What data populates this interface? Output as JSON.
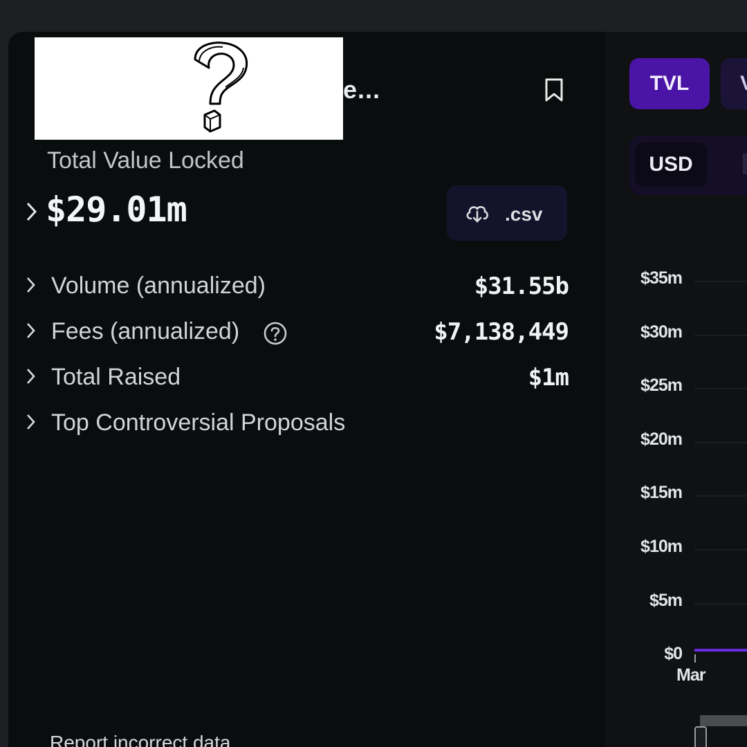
{
  "header": {
    "title_suffix": "e...",
    "bookmark_icon": "bookmark-icon"
  },
  "summary": {
    "tvl_label": "Total Value Locked",
    "tvl_value": "$29.01m",
    "csv_label": ".csv",
    "csv_icon": "cloud-download-icon"
  },
  "stats": [
    {
      "label": "Volume (annualized)",
      "value": "$31.55b"
    },
    {
      "label": "Fees (annualized)",
      "value": "$7,138,449"
    },
    {
      "label": "Total Raised",
      "value": "$1m"
    },
    {
      "label": "Top Controversial Proposals",
      "value": ""
    }
  ],
  "footer": {
    "report_link": "Report incorrect data"
  },
  "chart_controls": {
    "tabs": [
      "TVL",
      "V"
    ],
    "units": [
      "USD"
    ]
  },
  "chart_data": {
    "type": "line",
    "y_ticks": [
      "$35m",
      "$30m",
      "$25m",
      "$20m",
      "$15m",
      "$10m",
      "$5m",
      "$0"
    ],
    "x_ticks": [
      "Mar"
    ],
    "ylim": [
      0,
      35000000
    ],
    "series_color": "#6a2be0"
  },
  "colors": {
    "accent": "#4a14a6",
    "card_bg": "#0a0d0e",
    "page_bg": "#1e1f23"
  }
}
